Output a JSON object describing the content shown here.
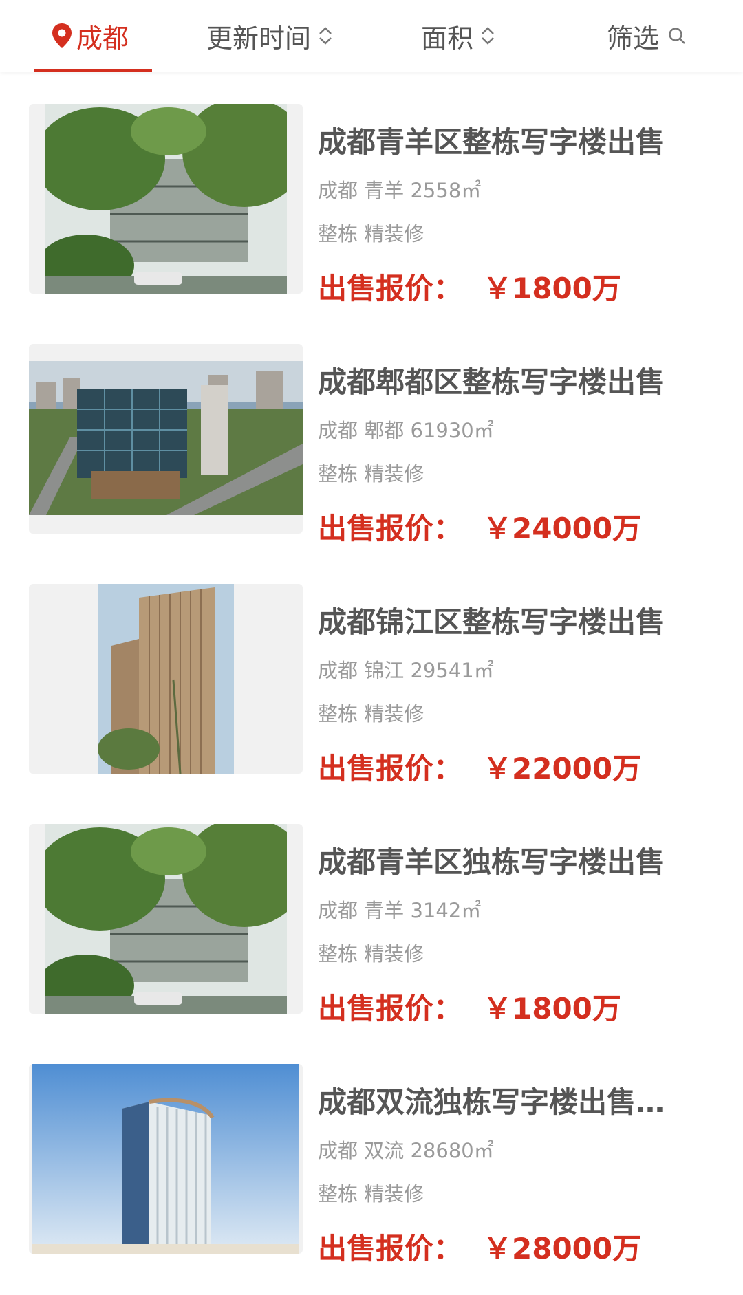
{
  "header": {
    "city": "成都",
    "sort_update": "更新时间",
    "sort_area": "面积",
    "filter": "筛选"
  },
  "listings": [
    {
      "title": "成都青羊区整栋写字楼出售",
      "city": "成都",
      "district": "青羊",
      "area": "2558㎡",
      "tags": "整栋 精装修",
      "price_label": "出售报价：",
      "price": "￥1800万"
    },
    {
      "title": "成都郫都区整栋写字楼出售",
      "city": "成都",
      "district": "郫都",
      "area": "61930㎡",
      "tags": "整栋 精装修",
      "price_label": "出售报价：",
      "price": "￥24000万"
    },
    {
      "title": "成都锦江区整栋写字楼出售",
      "city": "成都",
      "district": "锦江",
      "area": "29541㎡",
      "tags": "整栋 精装修",
      "price_label": "出售报价：",
      "price": "￥22000万"
    },
    {
      "title": "成都青羊区独栋写字楼出售",
      "city": "成都",
      "district": "青羊",
      "area": "3142㎡",
      "tags": "整栋 精装修",
      "price_label": "出售报价：",
      "price": "￥1800万"
    },
    {
      "title": "成都双流独栋写字楼出售…",
      "city": "成都",
      "district": "双流",
      "area": "28680㎡",
      "tags": "整栋 精装修",
      "price_label": "出售报价：",
      "price": "￥28000万"
    }
  ],
  "colors": {
    "accent": "#d42f1f",
    "title": "#555555",
    "meta": "#9a9a9a"
  }
}
